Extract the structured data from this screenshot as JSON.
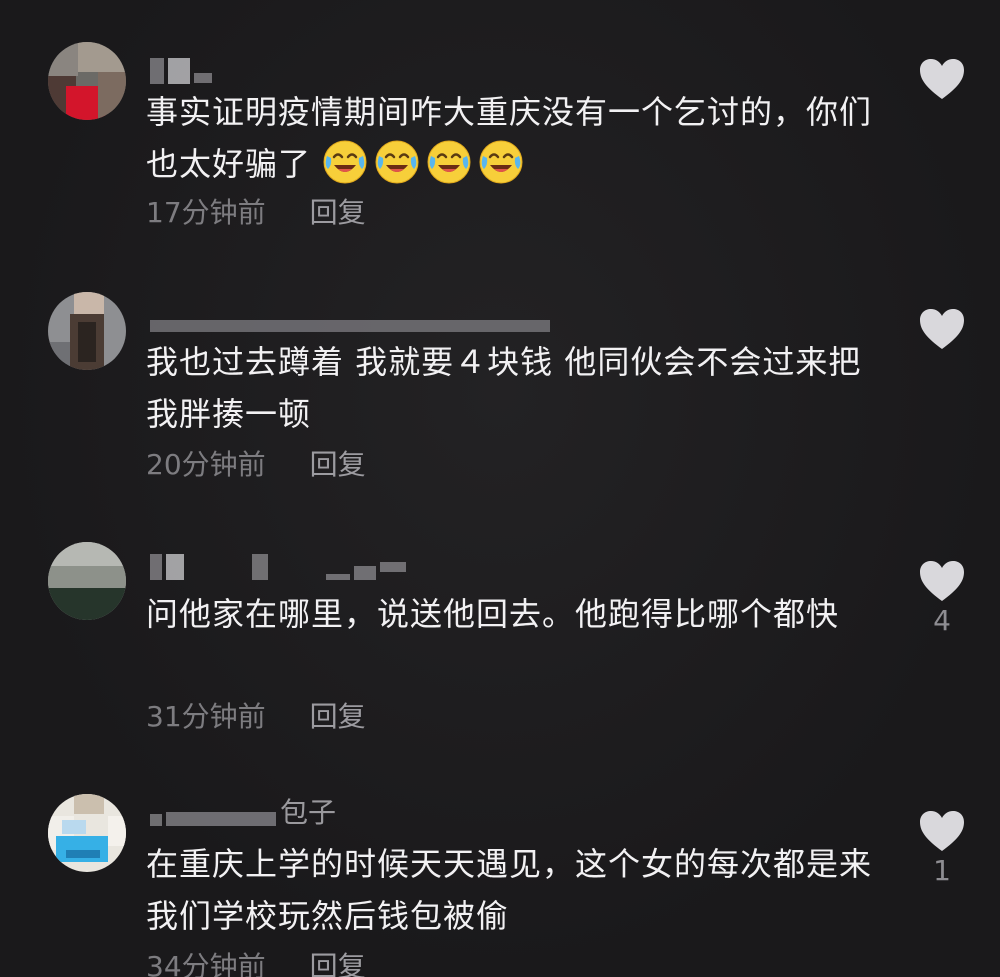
{
  "comments": [
    {
      "username": "",
      "text": "事实证明疫情期间咋大重庆没有一个乞讨的，你们也太好骗了",
      "emoji_name": "laughing-crying-face-icon",
      "emoji_count": 4,
      "time": "17分钟前",
      "reply_label": "回复",
      "likes": ""
    },
    {
      "username": "",
      "text": "我也过去蹲着 我就要４块钱 他同伙会不会过来把我胖揍一顿",
      "time": "20分钟前",
      "reply_label": "回复",
      "likes": ""
    },
    {
      "username": "",
      "text": "问他家在哪里，说送他回去。他跑得比哪个都快",
      "time": "31分钟前",
      "reply_label": "回复",
      "likes": "4"
    },
    {
      "username": "包子",
      "text": "在重庆上学的时候天天遇见，这个女的每次都是来我们学校玩然后钱包被偷",
      "time": "34分钟前",
      "reply_label": "回复",
      "likes": "1"
    }
  ],
  "colors": {
    "background": "#1b1a1c",
    "text": "#f2f1f3",
    "meta": "#7d7c80",
    "heart": "#d9d8dc"
  }
}
